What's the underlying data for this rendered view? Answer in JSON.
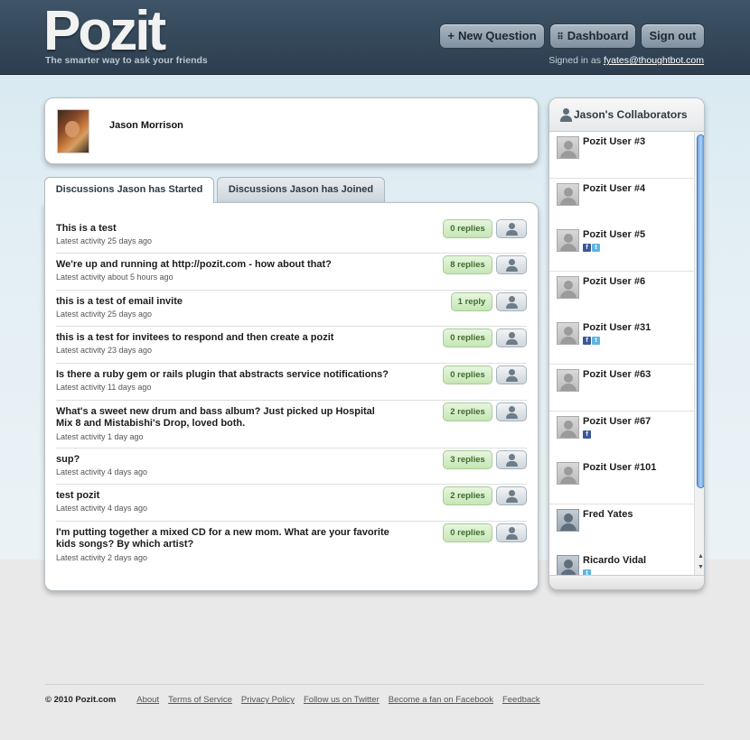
{
  "header": {
    "logo": "Pozit",
    "tagline": "The smarter way to ask your friends",
    "buttons": {
      "new_question": "New Question",
      "dashboard": "Dashboard",
      "sign_out": "Sign out"
    },
    "signed_in_label": "Signed in as",
    "signed_in_email": "fyates@thoughtbot.com"
  },
  "profile": {
    "name": "Jason Morrison"
  },
  "tabs": {
    "started": "Discussions Jason has Started",
    "joined": "Discussions Jason has Joined"
  },
  "discussions": [
    {
      "title": "This is a test",
      "meta": "Latest activity 25 days ago",
      "replies": "0 replies"
    },
    {
      "title": "We're up and running at http://pozit.com - how about that?",
      "meta": "Latest activity about 5 hours ago",
      "replies": "8 replies"
    },
    {
      "title": "this is a test of email invite",
      "meta": "Latest activity 25 days ago",
      "replies": "1 reply"
    },
    {
      "title": "this is a test for invitees to respond and then create a pozit",
      "meta": "Latest activity 23 days ago",
      "replies": "0 replies"
    },
    {
      "title": "Is there a ruby gem or rails plugin that abstracts service notifications?",
      "meta": "Latest activity 11 days ago",
      "replies": "0 replies"
    },
    {
      "title": "What's a sweet new drum and bass album? Just picked up Hospital Mix 8 and Mistabishi's Drop, loved both.",
      "meta": "Latest activity 1 day ago",
      "replies": "2 replies"
    },
    {
      "title": "sup?",
      "meta": "Latest activity 4 days ago",
      "replies": "3 replies"
    },
    {
      "title": "test pozit",
      "meta": "Latest activity 4 days ago",
      "replies": "2 replies"
    },
    {
      "title": "I'm putting together a mixed CD for a new mom. What are your favorite kids songs? By which artist?",
      "meta": "Latest activity 2 days ago",
      "replies": "0 replies"
    }
  ],
  "collaborators": {
    "title": "Jason's Collaborators",
    "items": [
      {
        "name": "Pozit User #3",
        "social": []
      },
      {
        "name": "Pozit User #4",
        "social": []
      },
      {
        "name": "Pozit User #5",
        "social": [
          "facebook",
          "twitter"
        ]
      },
      {
        "name": "Pozit User #6",
        "social": []
      },
      {
        "name": "Pozit User #31",
        "social": [
          "facebook",
          "twitter"
        ]
      },
      {
        "name": "Pozit User #63",
        "social": []
      },
      {
        "name": "Pozit User #67",
        "social": [
          "facebook"
        ]
      },
      {
        "name": "Pozit User #101",
        "social": []
      },
      {
        "name": "Fred Yates",
        "social": []
      },
      {
        "name": "Ricardo Vidal",
        "social": [
          "twitter"
        ]
      }
    ]
  },
  "footer": {
    "copyright": "© 2010 Pozit.com",
    "links": [
      "About",
      "Terms of Service",
      "Privacy Policy",
      "Follow us on Twitter",
      "Become a fan on Facebook",
      "Feedback"
    ]
  },
  "icons": {
    "new_question": "plus-icon",
    "dashboard": "grid-icon",
    "person": "person-icon",
    "facebook": "facebook-icon",
    "twitter": "twitter-icon"
  },
  "colors": {
    "header_bg": "#34475a",
    "replies_green": "#c6e6b6",
    "scroll_thumb": "#6aa4e6"
  }
}
